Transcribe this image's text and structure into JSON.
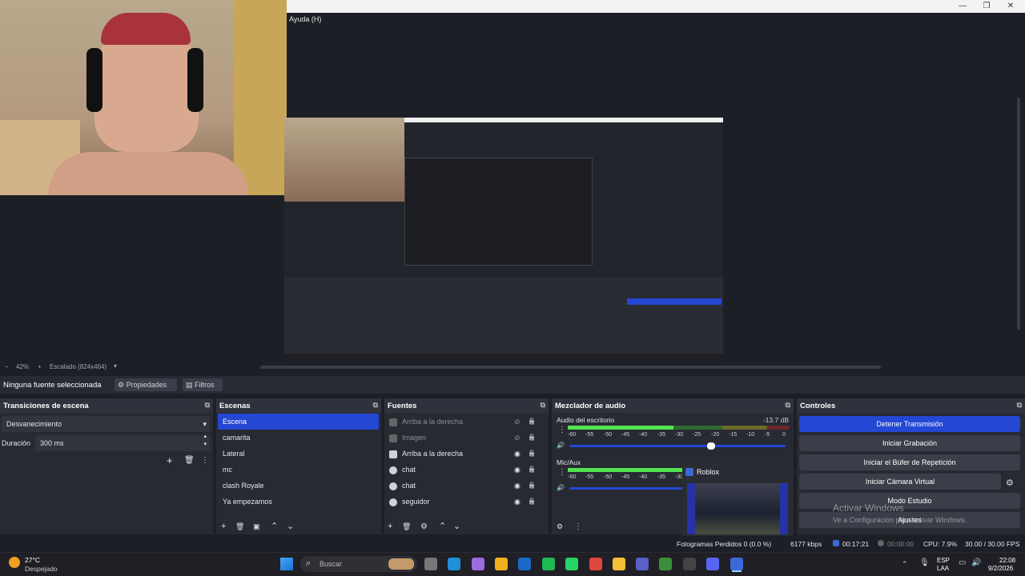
{
  "window": {
    "menu_label": "Ayuda (H)"
  },
  "preview_toolbar": {
    "zoom": "42%",
    "scale": "Escalado (824x464)"
  },
  "source_bar": {
    "label": "Ninguna fuente seleccionada",
    "properties": "Propiedades",
    "filters": "Filtros"
  },
  "transitions": {
    "title": "Transiciones de escena",
    "type": "Desvanecimiento",
    "duration_label": "Duración",
    "duration_value": "300 ms"
  },
  "scenes": {
    "title": "Escenas",
    "items": [
      "Escena",
      "camarita",
      "Lateral",
      "mc",
      "clash Royale",
      "Ya empezamos"
    ],
    "selected": 0
  },
  "sources": {
    "title": "Fuentes",
    "items": [
      {
        "name": "Arriba a la derecha",
        "icon": "image-icon",
        "hidden": true
      },
      {
        "name": "Imagen",
        "icon": "image-icon",
        "hidden": true
      },
      {
        "name": "Arriba a la derecha",
        "icon": "image-icon",
        "hidden": false
      },
      {
        "name": "chat",
        "icon": "browser-icon",
        "hidden": false
      },
      {
        "name": "chat",
        "icon": "browser-icon",
        "hidden": false
      },
      {
        "name": "seguidor",
        "icon": "browser-icon",
        "hidden": false
      }
    ]
  },
  "mixer": {
    "title": "Mezclador de audio",
    "channels": [
      {
        "name": "Audio del escritorio",
        "db": "-13.7 dB",
        "level": 0.48
      },
      {
        "name": "Mic/Aux",
        "db": "",
        "level": 0.62
      }
    ],
    "ticks": [
      "-60",
      "-55",
      "-50",
      "-45",
      "-40",
      "-35",
      "-30",
      "-25",
      "-20",
      "-15",
      "-10",
      "-5",
      "0"
    ]
  },
  "controls": {
    "title": "Controles",
    "buttons": [
      "Detener Transmisión",
      "Iniciar Grabación",
      "Iniciar el Búfer de Repetición",
      "Iniciar Cámara Virtual",
      "Modo Estudio",
      "Ajustes"
    ]
  },
  "watermark": {
    "line1": "Activar Windows",
    "line2": "Ve a Configuración para activar Windows."
  },
  "roblox_popup": {
    "title": "Roblox"
  },
  "status": {
    "dropped": "Fotogramas Perdidos 0 (0.0 %)",
    "bitrate": "6177 kbps",
    "live_time": "00:17:21",
    "rec_time": "00:00:00",
    "cpu": "CPU: 7.9%",
    "fps": "30.00 / 30.00 FPS"
  },
  "taskbar": {
    "weather_temp": "27°C",
    "weather_desc": "Despejado",
    "search_placeholder": "Buscar",
    "lang1": "ESP",
    "lang2": "LAA",
    "time": "22:08",
    "date": "9/2/2026"
  },
  "colors": {
    "accent": "#2447d4",
    "meter_green": "#52e34f",
    "meter_yellow": "#d7d84a",
    "meter_red": "#e04545"
  }
}
